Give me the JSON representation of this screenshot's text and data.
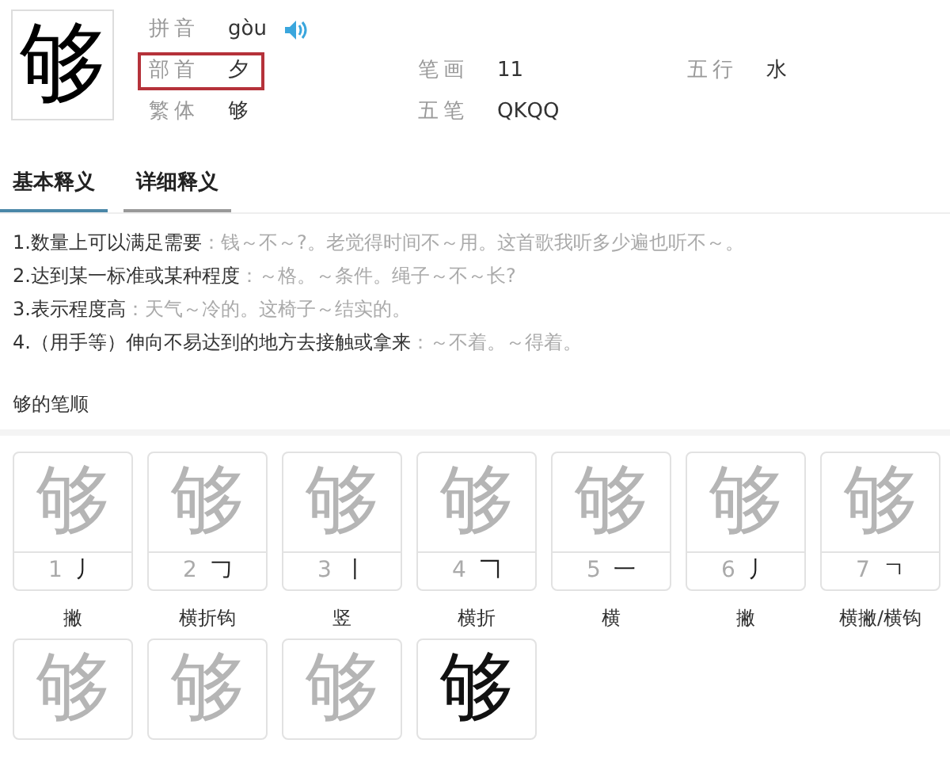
{
  "character": "够",
  "info": [
    {
      "label": "拼音",
      "value": "gòu",
      "kind": "pinyin",
      "highlighted": false
    },
    {
      "label": "部首",
      "value": "夕",
      "kind": "plain",
      "highlighted": true
    },
    {
      "label": "笔画",
      "value": "11",
      "kind": "plain",
      "highlighted": false
    },
    {
      "label": "五行",
      "value": "水",
      "kind": "plain",
      "highlighted": false
    },
    {
      "label": "繁体",
      "value": "够",
      "kind": "plain",
      "highlighted": false
    },
    {
      "label": "五笔",
      "value": "QKQQ",
      "kind": "plain",
      "highlighted": false
    }
  ],
  "tabs": [
    {
      "label": "基本释义",
      "selected": true
    },
    {
      "label": "详细释义",
      "selected": false
    }
  ],
  "definitions": [
    {
      "meaning": "1.数量上可以满足需要",
      "example": "：钱～不～?。老觉得时间不～用。这首歌我听多少遍也听不～。"
    },
    {
      "meaning": "2.达到某一标准或某种程度",
      "example": "：～格。～条件。绳子～不～长?"
    },
    {
      "meaning": "3.表示程度高",
      "example": "：天气～冷的。这椅子～结实的。"
    },
    {
      "meaning": "4.（用手等）伸向不易达到的地方去接触或拿来",
      "example": "：～不着。～得着。"
    }
  ],
  "stroke_order_title": "够的笔顺",
  "strokes": [
    {
      "glyph": "够",
      "number": "1",
      "stroke": "丿",
      "name": "撇",
      "complete": false
    },
    {
      "glyph": "够",
      "number": "2",
      "stroke": "𠃌",
      "name": "横折钩",
      "complete": false
    },
    {
      "glyph": "够",
      "number": "3",
      "stroke": "丨",
      "name": "竖",
      "complete": false
    },
    {
      "glyph": "够",
      "number": "4",
      "stroke": "𠃍",
      "name": "横折",
      "complete": false
    },
    {
      "glyph": "够",
      "number": "5",
      "stroke": "一",
      "name": "横",
      "complete": false
    },
    {
      "glyph": "够",
      "number": "6",
      "stroke": "丿",
      "name": "撇",
      "complete": false
    },
    {
      "glyph": "够",
      "number": "7",
      "stroke": "ㄱ",
      "name": "横撇/横钩",
      "complete": false
    },
    {
      "glyph": "够",
      "complete": false
    },
    {
      "glyph": "够",
      "complete": false
    },
    {
      "glyph": "够",
      "complete": false
    },
    {
      "glyph": "够",
      "complete": true
    }
  ]
}
